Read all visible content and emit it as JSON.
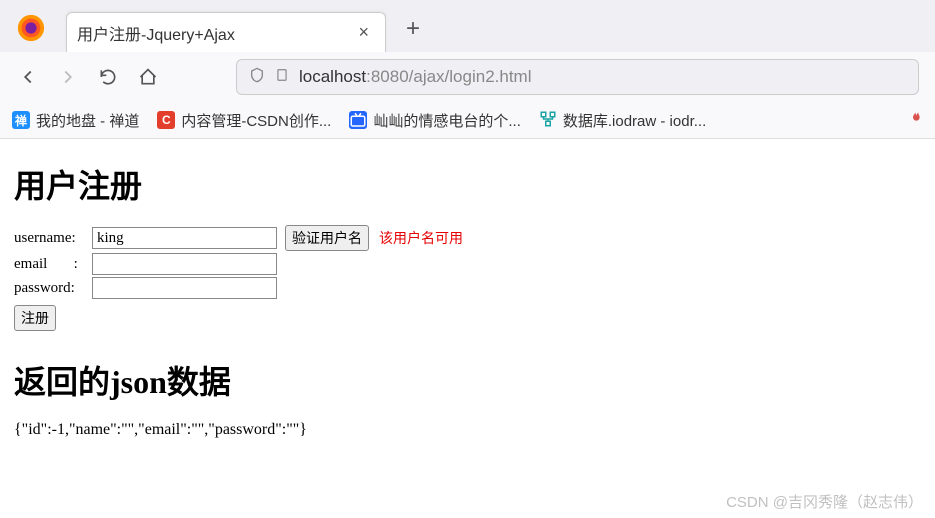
{
  "browser": {
    "tab_title": "用户注册-Jquery+Ajax",
    "url_host": "localhost",
    "url_port_path": ":8080/ajax/login2.html"
  },
  "bookmarks": [
    {
      "label": "我的地盘 - 禅道",
      "icon_bg": "#1e90ff",
      "icon_char": "禅"
    },
    {
      "label": "内容管理-CSDN创作...",
      "icon_bg": "#e33e2b",
      "icon_char": "C"
    },
    {
      "label": "屾屾的情感电台的个...",
      "icon_bg": "#2566ff",
      "icon_char": "b"
    },
    {
      "label": "数据库.iodraw - iodr...",
      "icon_bg": "transparent",
      "icon_char": ""
    }
  ],
  "page": {
    "heading": "用户注册",
    "username_label": "username:",
    "username_value": "king",
    "email_label": "email       :",
    "email_value": "",
    "password_label": "password:",
    "password_value": "",
    "validate_btn": "验证用户名",
    "status_msg": "该用户名可用",
    "register_btn": "注册",
    "json_heading": "返回的json数据",
    "json_output": "{\"id\":-1,\"name\":\"\",\"email\":\"\",\"password\":\"\"}"
  },
  "watermark": "CSDN @吉冈秀隆（赵志伟）"
}
